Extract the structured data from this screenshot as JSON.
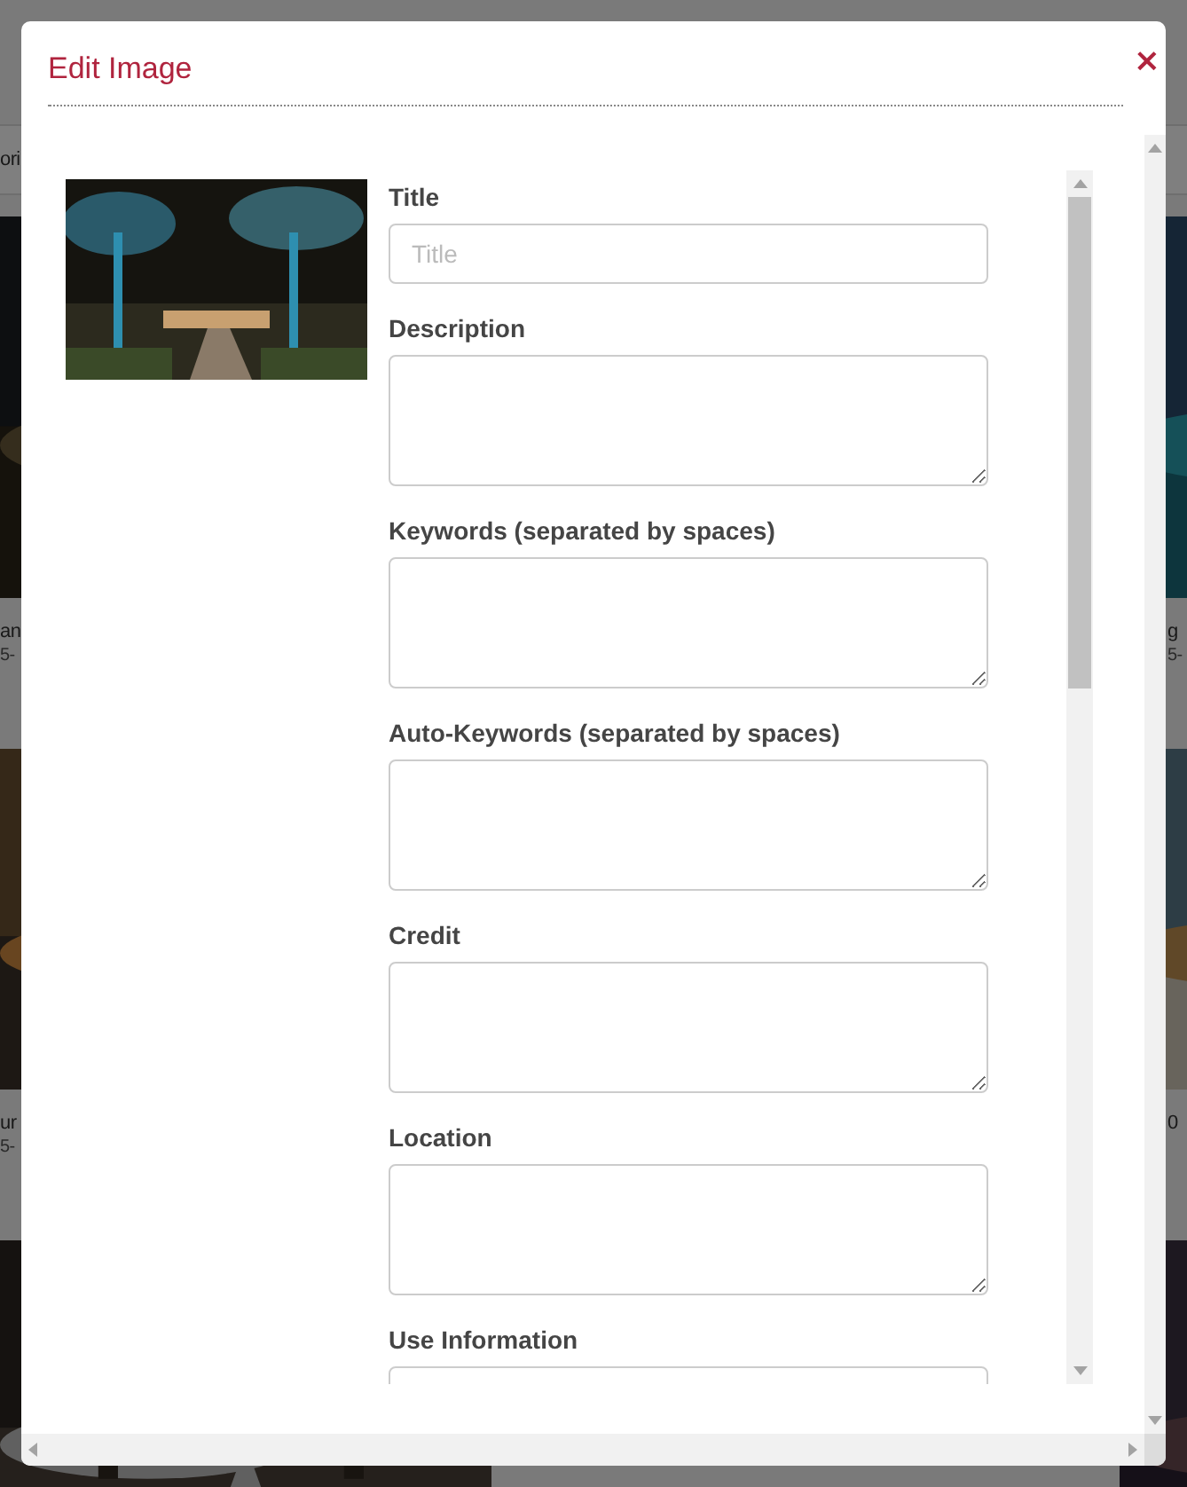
{
  "background": {
    "toolbar_text": "ori",
    "left_captions": [
      {
        "title": "an",
        "date": "5-"
      },
      {
        "title": "ur",
        "date": "5-"
      }
    ],
    "right_captions": [
      {
        "title": "g",
        "date": "5-"
      },
      {
        "title": "0"
      }
    ]
  },
  "dialog": {
    "title": "Edit Image",
    "close": "×",
    "fields": [
      {
        "kind": "input",
        "label": "Title",
        "placeholder": "Title"
      },
      {
        "kind": "textarea",
        "label": "Description"
      },
      {
        "kind": "textarea",
        "label": "Keywords (separated by spaces)"
      },
      {
        "kind": "textarea",
        "label": "Auto-Keywords (separated by spaces)"
      },
      {
        "kind": "textarea",
        "label": "Credit"
      },
      {
        "kind": "textarea",
        "label": "Location"
      },
      {
        "kind": "textarea",
        "label": "Use Information"
      }
    ]
  }
}
